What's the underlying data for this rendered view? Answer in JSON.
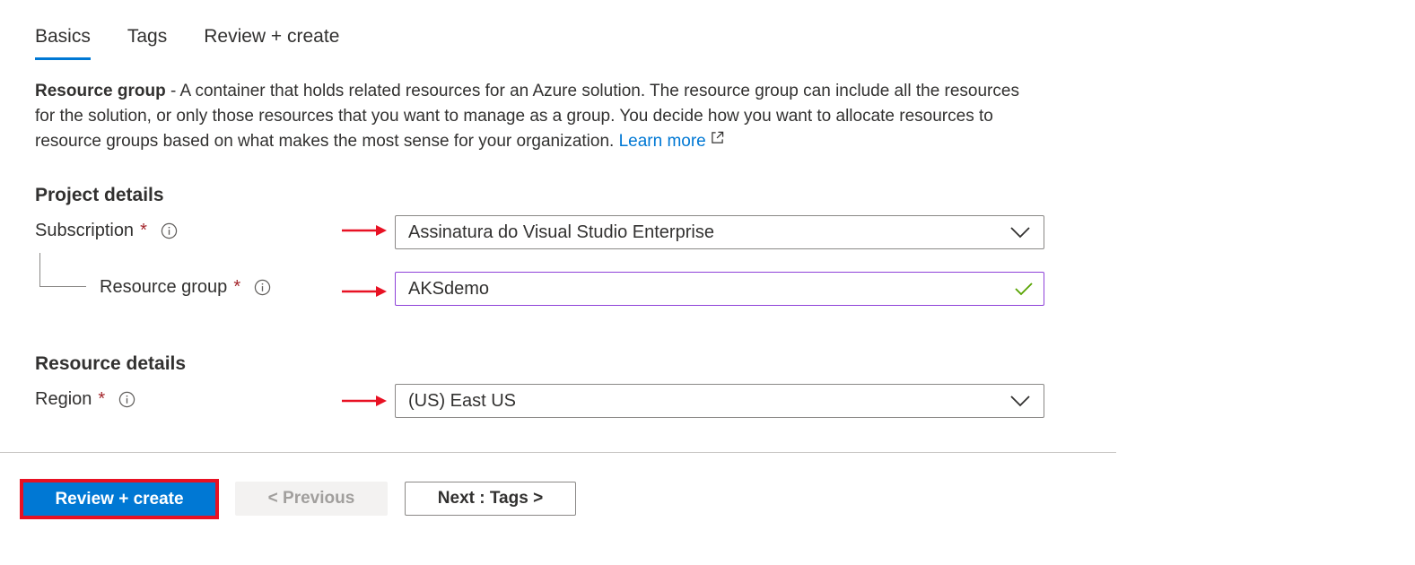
{
  "tabs": [
    {
      "label": "Basics",
      "active": true
    },
    {
      "label": "Tags",
      "active": false
    },
    {
      "label": "Review + create",
      "active": false
    }
  ],
  "description": {
    "bold": "Resource group",
    "text": " - A container that holds related resources for an Azure solution. The resource group can include all the resources for the solution, or only those resources that you want to manage as a group. You decide how you want to allocate resources to resource groups based on what makes the most sense for your organization. ",
    "link": "Learn more"
  },
  "project": {
    "title": "Project details",
    "subscription": {
      "label": "Subscription",
      "required": "*",
      "value": "Assinatura do Visual Studio Enterprise"
    },
    "resource_group": {
      "label": "Resource group",
      "required": "*",
      "value": "AKSdemo"
    }
  },
  "resource": {
    "title": "Resource details",
    "region": {
      "label": "Region",
      "required": "*",
      "value": "(US) East US"
    }
  },
  "footer": {
    "review_create": "Review + create",
    "previous": "< Previous",
    "next": "Next : Tags >"
  },
  "colors": {
    "accent": "#0078d4",
    "required": "#a4262c",
    "annotation": "#e81123",
    "valid_border": "#8f42d8",
    "check": "#57a300"
  },
  "icons": [
    "info-icon",
    "external-link-icon",
    "chevron-down-icon",
    "checkmark-icon",
    "arrow-right-icon"
  ]
}
